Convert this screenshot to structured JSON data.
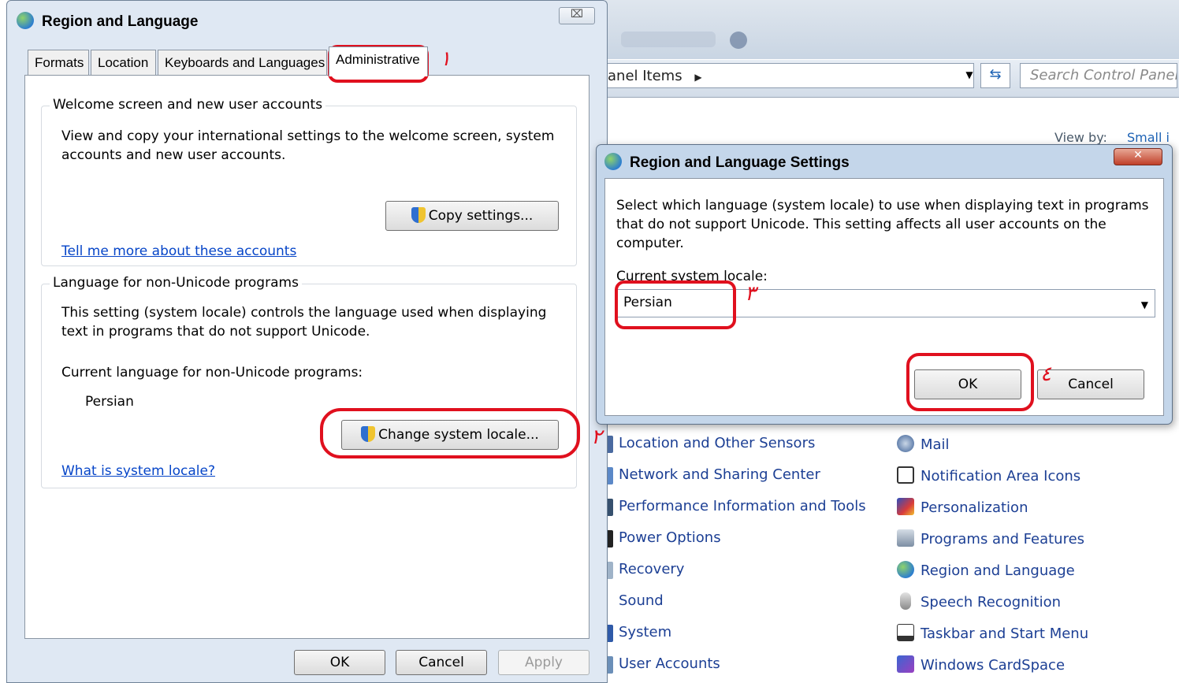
{
  "control_panel": {
    "address": "anel Items",
    "search_placeholder": "Search Control Panel",
    "view_by_label": "View by:",
    "view_by_value": "Small i",
    "left_column": [
      "Location and Other Sensors",
      "Network and Sharing Center",
      "Performance Information and Tools",
      "Power Options",
      "Recovery",
      "Sound",
      "System",
      "User Accounts"
    ],
    "right_column": [
      "Mail",
      "Notification Area Icons",
      "Personalization",
      "Programs and Features",
      "Region and Language",
      "Speech Recognition",
      "Taskbar and Start Menu",
      "Windows CardSpace"
    ],
    "icons": [
      "mail-icon",
      "notification-icon",
      "personalization-icon",
      "programs-icon",
      "globe-icon",
      "microphone-icon",
      "taskbar-icon",
      "cardspace-icon"
    ]
  },
  "region_window": {
    "title": "Region and Language",
    "close_glyph": "⌧",
    "tabs": [
      "Formats",
      "Location",
      "Keyboards and Languages",
      "Administrative"
    ],
    "welcome": {
      "legend": "Welcome screen and new user accounts",
      "desc_line1": "View and copy your international settings to the welcome screen, system",
      "desc_line2": "accounts and new user accounts.",
      "copy_button": "Copy settings...",
      "link": "Tell me more about these accounts"
    },
    "nonunicode": {
      "legend": "Language for non-Unicode programs",
      "desc_line1": "This setting (system locale) controls the language used when displaying",
      "desc_line2": "text in programs that do not support Unicode.",
      "current_label": "Current language for non-Unicode programs:",
      "current_value": "Persian",
      "change_button": "Change system locale...",
      "link": "What is system locale?"
    },
    "footer": {
      "ok": "OK",
      "cancel": "Cancel",
      "apply": "Apply"
    }
  },
  "settings_dialog": {
    "title": "Region and Language Settings",
    "close_glyph": "✕",
    "desc_line1": "Select which language (system locale) to use when displaying text in programs",
    "desc_line2": "that do not support Unicode. This setting affects all user accounts on the",
    "desc_line3": "computer.",
    "locale_label": "Current system locale:",
    "locale_value": "Persian",
    "ok": "OK",
    "cancel": "Cancel"
  },
  "annotations": {
    "step1": "١",
    "step2": "٢",
    "step3": "٣",
    "step4": "٤",
    "color": "#e0101e"
  }
}
